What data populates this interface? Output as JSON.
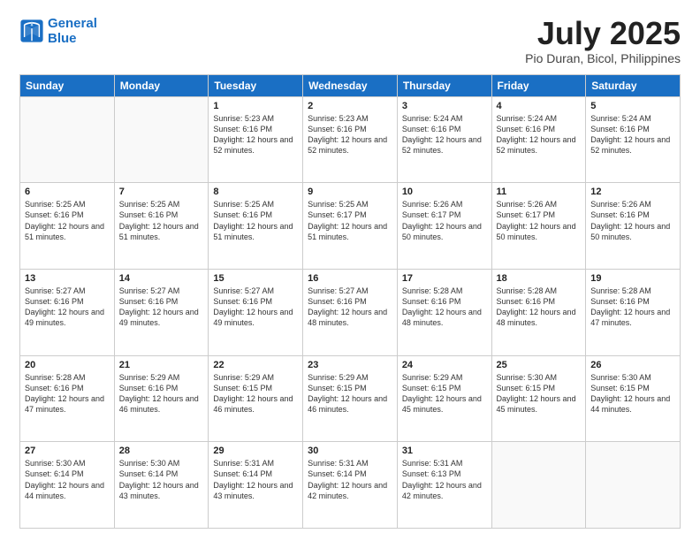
{
  "logo": {
    "line1": "General",
    "line2": "Blue"
  },
  "title": "July 2025",
  "subtitle": "Pio Duran, Bicol, Philippines",
  "weekdays": [
    "Sunday",
    "Monday",
    "Tuesday",
    "Wednesday",
    "Thursday",
    "Friday",
    "Saturday"
  ],
  "weeks": [
    [
      {
        "day": "",
        "info": ""
      },
      {
        "day": "",
        "info": ""
      },
      {
        "day": "1",
        "info": "Sunrise: 5:23 AM\nSunset: 6:16 PM\nDaylight: 12 hours and 52 minutes."
      },
      {
        "day": "2",
        "info": "Sunrise: 5:23 AM\nSunset: 6:16 PM\nDaylight: 12 hours and 52 minutes."
      },
      {
        "day": "3",
        "info": "Sunrise: 5:24 AM\nSunset: 6:16 PM\nDaylight: 12 hours and 52 minutes."
      },
      {
        "day": "4",
        "info": "Sunrise: 5:24 AM\nSunset: 6:16 PM\nDaylight: 12 hours and 52 minutes."
      },
      {
        "day": "5",
        "info": "Sunrise: 5:24 AM\nSunset: 6:16 PM\nDaylight: 12 hours and 52 minutes."
      }
    ],
    [
      {
        "day": "6",
        "info": "Sunrise: 5:25 AM\nSunset: 6:16 PM\nDaylight: 12 hours and 51 minutes."
      },
      {
        "day": "7",
        "info": "Sunrise: 5:25 AM\nSunset: 6:16 PM\nDaylight: 12 hours and 51 minutes."
      },
      {
        "day": "8",
        "info": "Sunrise: 5:25 AM\nSunset: 6:16 PM\nDaylight: 12 hours and 51 minutes."
      },
      {
        "day": "9",
        "info": "Sunrise: 5:25 AM\nSunset: 6:17 PM\nDaylight: 12 hours and 51 minutes."
      },
      {
        "day": "10",
        "info": "Sunrise: 5:26 AM\nSunset: 6:17 PM\nDaylight: 12 hours and 50 minutes."
      },
      {
        "day": "11",
        "info": "Sunrise: 5:26 AM\nSunset: 6:17 PM\nDaylight: 12 hours and 50 minutes."
      },
      {
        "day": "12",
        "info": "Sunrise: 5:26 AM\nSunset: 6:16 PM\nDaylight: 12 hours and 50 minutes."
      }
    ],
    [
      {
        "day": "13",
        "info": "Sunrise: 5:27 AM\nSunset: 6:16 PM\nDaylight: 12 hours and 49 minutes."
      },
      {
        "day": "14",
        "info": "Sunrise: 5:27 AM\nSunset: 6:16 PM\nDaylight: 12 hours and 49 minutes."
      },
      {
        "day": "15",
        "info": "Sunrise: 5:27 AM\nSunset: 6:16 PM\nDaylight: 12 hours and 49 minutes."
      },
      {
        "day": "16",
        "info": "Sunrise: 5:27 AM\nSunset: 6:16 PM\nDaylight: 12 hours and 48 minutes."
      },
      {
        "day": "17",
        "info": "Sunrise: 5:28 AM\nSunset: 6:16 PM\nDaylight: 12 hours and 48 minutes."
      },
      {
        "day": "18",
        "info": "Sunrise: 5:28 AM\nSunset: 6:16 PM\nDaylight: 12 hours and 48 minutes."
      },
      {
        "day": "19",
        "info": "Sunrise: 5:28 AM\nSunset: 6:16 PM\nDaylight: 12 hours and 47 minutes."
      }
    ],
    [
      {
        "day": "20",
        "info": "Sunrise: 5:28 AM\nSunset: 6:16 PM\nDaylight: 12 hours and 47 minutes."
      },
      {
        "day": "21",
        "info": "Sunrise: 5:29 AM\nSunset: 6:16 PM\nDaylight: 12 hours and 46 minutes."
      },
      {
        "day": "22",
        "info": "Sunrise: 5:29 AM\nSunset: 6:15 PM\nDaylight: 12 hours and 46 minutes."
      },
      {
        "day": "23",
        "info": "Sunrise: 5:29 AM\nSunset: 6:15 PM\nDaylight: 12 hours and 46 minutes."
      },
      {
        "day": "24",
        "info": "Sunrise: 5:29 AM\nSunset: 6:15 PM\nDaylight: 12 hours and 45 minutes."
      },
      {
        "day": "25",
        "info": "Sunrise: 5:30 AM\nSunset: 6:15 PM\nDaylight: 12 hours and 45 minutes."
      },
      {
        "day": "26",
        "info": "Sunrise: 5:30 AM\nSunset: 6:15 PM\nDaylight: 12 hours and 44 minutes."
      }
    ],
    [
      {
        "day": "27",
        "info": "Sunrise: 5:30 AM\nSunset: 6:14 PM\nDaylight: 12 hours and 44 minutes."
      },
      {
        "day": "28",
        "info": "Sunrise: 5:30 AM\nSunset: 6:14 PM\nDaylight: 12 hours and 43 minutes."
      },
      {
        "day": "29",
        "info": "Sunrise: 5:31 AM\nSunset: 6:14 PM\nDaylight: 12 hours and 43 minutes."
      },
      {
        "day": "30",
        "info": "Sunrise: 5:31 AM\nSunset: 6:14 PM\nDaylight: 12 hours and 42 minutes."
      },
      {
        "day": "31",
        "info": "Sunrise: 5:31 AM\nSunset: 6:13 PM\nDaylight: 12 hours and 42 minutes."
      },
      {
        "day": "",
        "info": ""
      },
      {
        "day": "",
        "info": ""
      }
    ]
  ]
}
